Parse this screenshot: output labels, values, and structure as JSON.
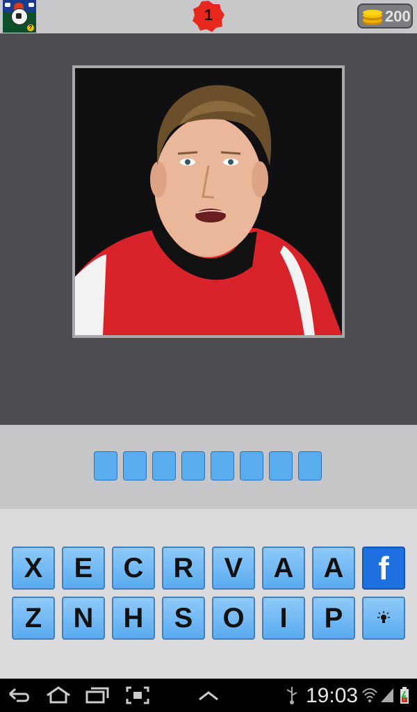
{
  "header": {
    "level": "1",
    "coins": "200",
    "app_icon": "football-quiz-app-icon",
    "coin_icon": "gold-coins-icon"
  },
  "puzzle": {
    "image": "football-player-photo",
    "answer_slots": [
      "",
      "",
      "",
      "",
      "",
      "",
      "",
      ""
    ]
  },
  "keyboard": {
    "row1": [
      "X",
      "E",
      "C",
      "R",
      "V",
      "A",
      "A"
    ],
    "row2": [
      "Z",
      "N",
      "H",
      "S",
      "O",
      "I",
      "P"
    ],
    "facebook_label": "f",
    "hint_icon": "lightbulb-icon"
  },
  "status_bar": {
    "time": "19:03",
    "icons": [
      "back-icon",
      "home-icon",
      "recent-apps-icon",
      "screenshot-icon",
      "up-chevron-icon",
      "usb-icon",
      "wifi-icon",
      "signal-icon",
      "battery-icon"
    ]
  },
  "colors": {
    "key_blue": "#5aaaf0",
    "facebook_blue": "#1e6fe0",
    "badge_red": "#e8271d"
  }
}
